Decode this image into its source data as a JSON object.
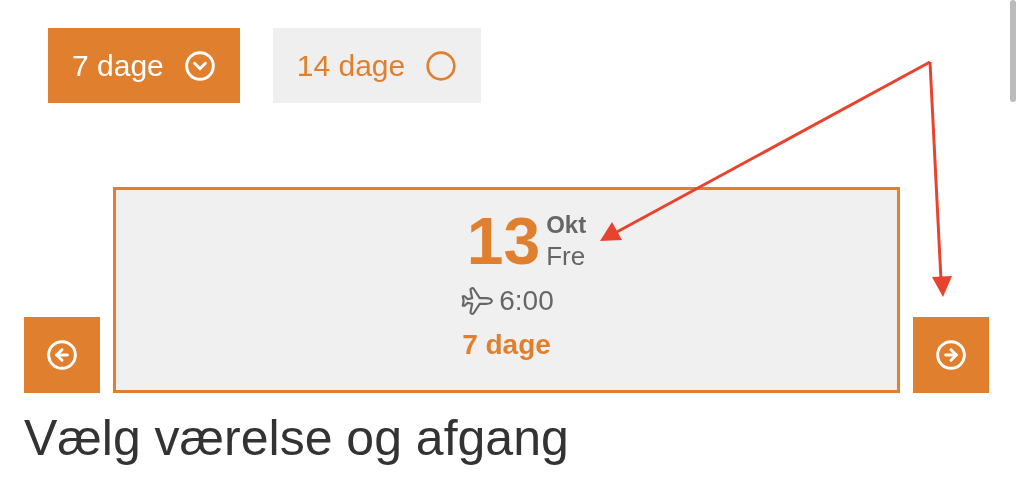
{
  "options": [
    {
      "label": "7 dage",
      "selected": true
    },
    {
      "label": "14 dage",
      "selected": false
    }
  ],
  "departure": {
    "day": "13",
    "month": "Okt",
    "weekday": "Fre",
    "time": "6:00",
    "duration": "7 dage"
  },
  "heading": "Vælg værelse og afgang"
}
